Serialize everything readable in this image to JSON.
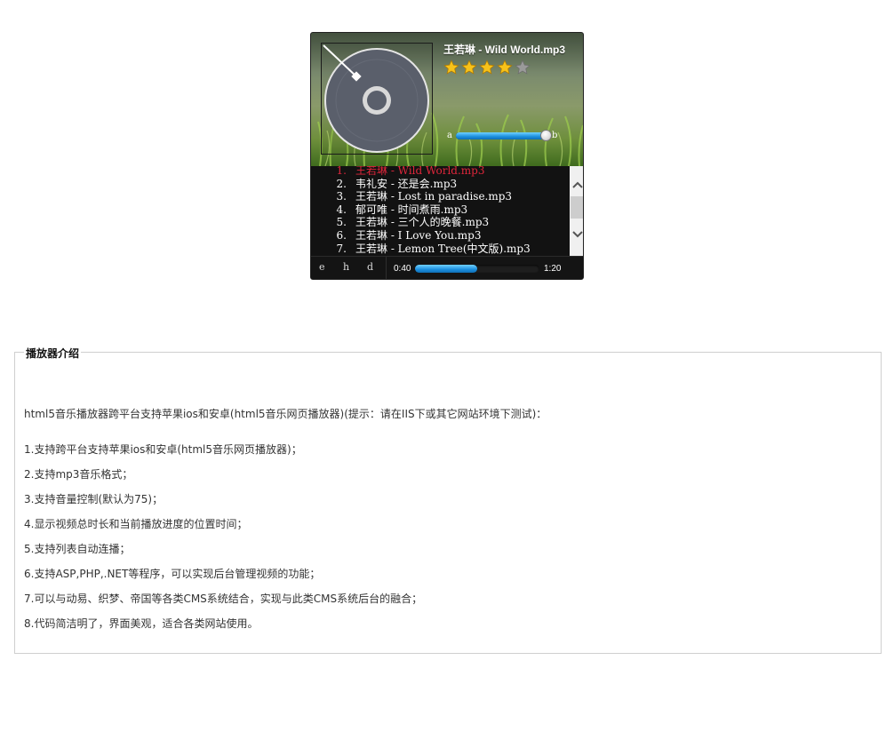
{
  "player": {
    "title": "王若琳 - Wild World.mp3",
    "rating": 4,
    "rating_max": 5,
    "volume": 0.97,
    "volume_left_label": "a",
    "volume_right_label": "b",
    "scroll_up": "^",
    "scroll_down": "v",
    "controls": {
      "e": "e",
      "h": "h",
      "d": "d"
    },
    "current_time": "0:40",
    "total_time": "1:20",
    "progress": 0.5,
    "colors": {
      "accent": "#1b8fde",
      "active_track": "#e0263b",
      "star": "#f7c21a"
    }
  },
  "playlist": [
    {
      "num": "1.",
      "title": "王若琳 - Wild World.mp3"
    },
    {
      "num": "2.",
      "title": "韦礼安 - 还是会.mp3"
    },
    {
      "num": "3.",
      "title": "王若琳 - Lost in paradise.mp3"
    },
    {
      "num": "4.",
      "title": "郁可唯 - 时间煮雨.mp3"
    },
    {
      "num": "5.",
      "title": "王若琳 - 三个人的晚餐.mp3"
    },
    {
      "num": "6.",
      "title": "王若琳 - I Love You.mp3"
    },
    {
      "num": "7.",
      "title": "王若琳 - Lemon Tree(中文版).mp3"
    }
  ],
  "intro": {
    "legend": "播放器介绍",
    "lines": [
      "html5音乐播放器跨平台支持苹果ios和安卓(html5音乐网页播放器)(提示：请在IIS下或其它网站环境下测试)：",
      "1.支持跨平台支持苹果ios和安卓(html5音乐网页播放器)；",
      "2.支持mp3音乐格式；",
      "3.支持音量控制(默认为75)；",
      "4.显示视频总时长和当前播放进度的位置时间；",
      "5.支持列表自动连播；",
      "6.支持ASP,PHP,.NET等程序，可以实现后台管理视频的功能；",
      "7.可以与动易、织梦、帝国等各类CMS系统结合，实现与此类CMS系统后台的融合；",
      "8.代码简洁明了，界面美观，适合各类网站使用。"
    ]
  }
}
